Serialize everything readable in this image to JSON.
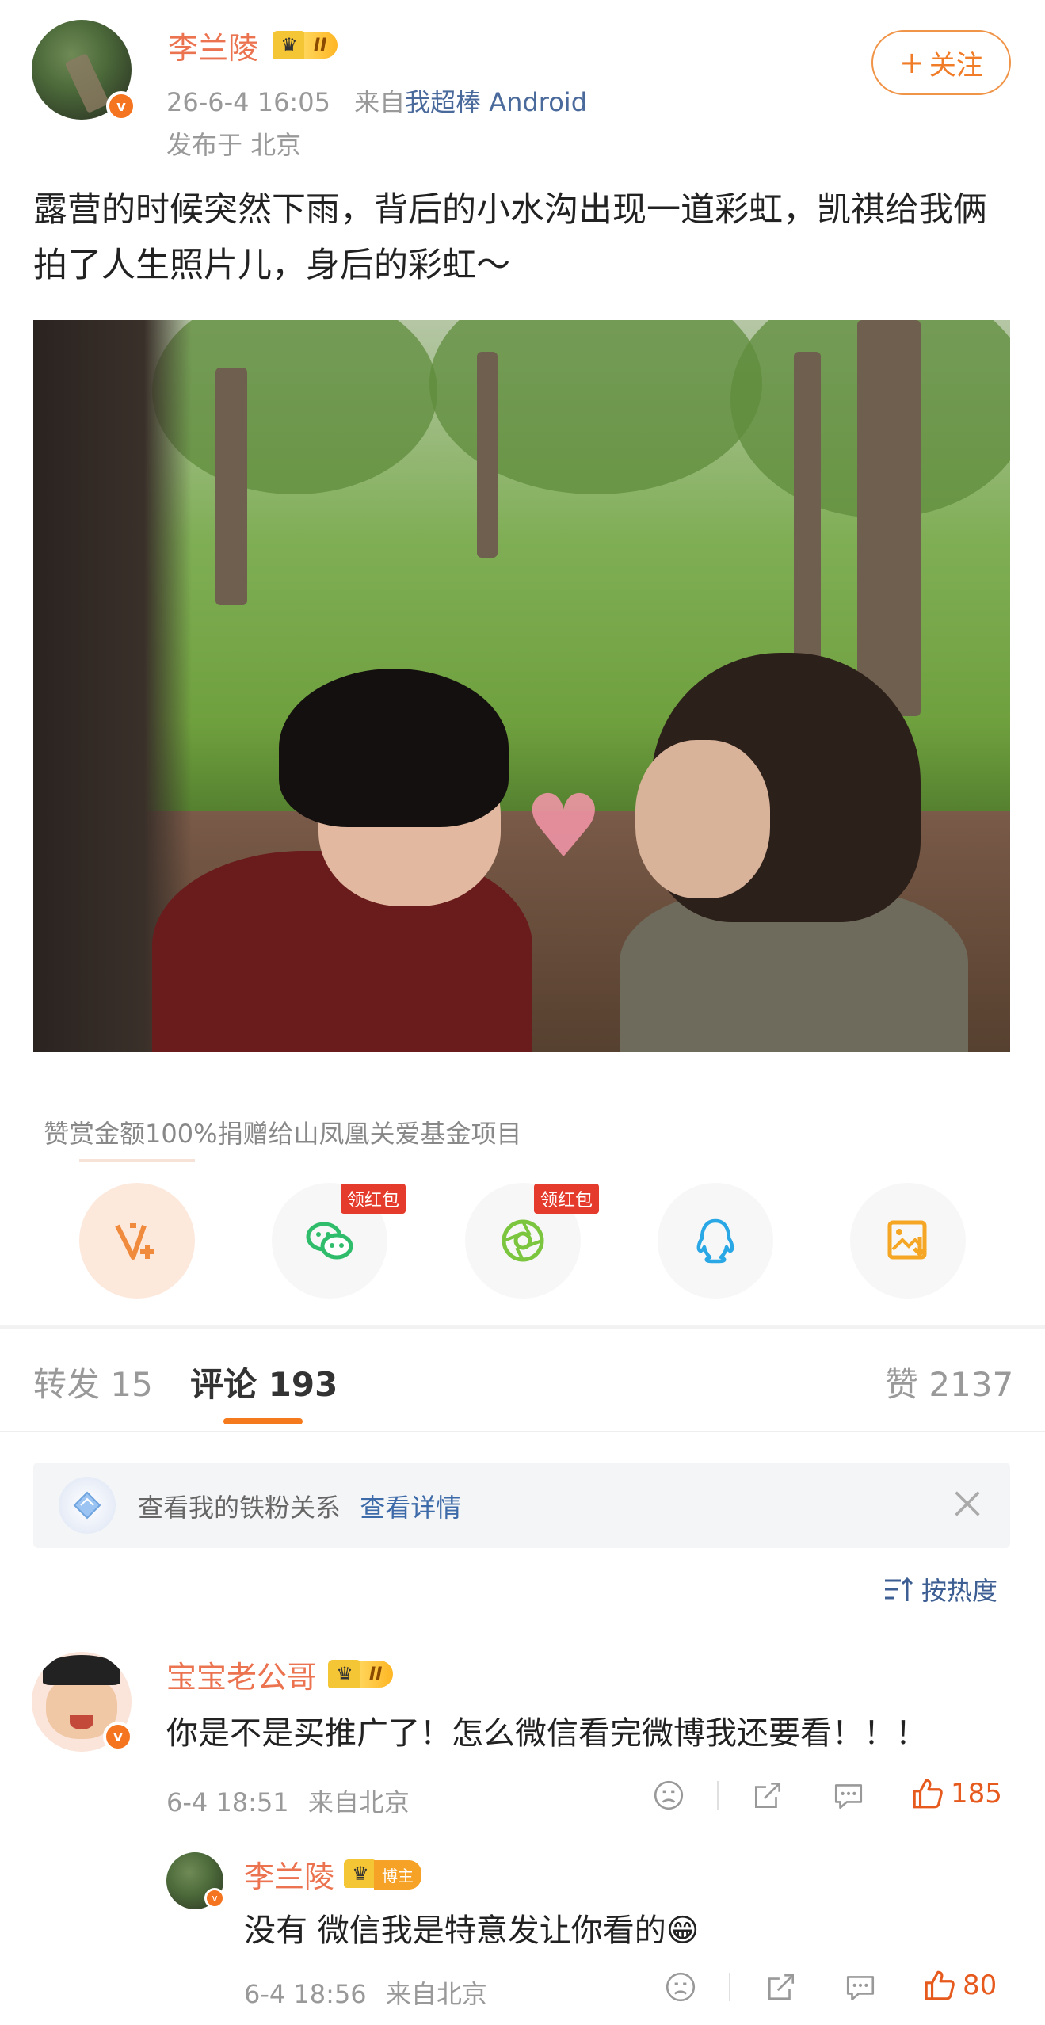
{
  "post": {
    "author": "李兰陵",
    "level": "II",
    "time": "26-6-4 16:05",
    "from_prefix": "来自",
    "source": "我超棒 Android",
    "location": "发布于 北京",
    "follow_label": "关注",
    "text": "露营的时候突然下雨，背后的小水沟出现一道彩虹，凯祺给我俩拍了人生照片儿，身后的彩虹～"
  },
  "reward": {
    "note": "赞赏金额100%捐赠给山凤凰关爱基金项目",
    "hongbao": "领红包"
  },
  "tabs": {
    "repost": "转发 15",
    "comment": "评论 193",
    "like": "赞 2137"
  },
  "fan_banner": {
    "text": "查看我的铁粉关系",
    "link": "查看详情"
  },
  "sort_label": "按热度",
  "comments": [
    {
      "name": "宝宝老公哥",
      "level": "II",
      "text": "你是不是买推广了！怎么微信看完微博我还要看！！！",
      "time": "6-4 18:51",
      "from": "来自北京",
      "likes": "185"
    },
    {
      "name": "李兰陵",
      "tag": "博主",
      "text": "没有 微信我是特意发让你看的😁",
      "time": "6-4 18:56",
      "from": "来自北京",
      "likes": "80"
    }
  ],
  "colors": {
    "accent": "#f57a1d",
    "name": "#eb7350",
    "link": "#3d6aa8"
  }
}
